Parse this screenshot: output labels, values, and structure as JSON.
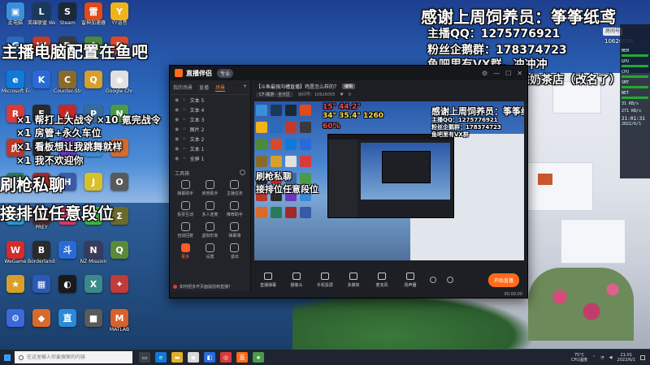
{
  "colors": {
    "accent": "#ff6a1a",
    "taskbar": "#1f2530",
    "app_bg": "#1e1f24"
  },
  "desktop_icons": [
    {
      "label": "此电脑",
      "icon": "computer-icon",
      "color": "#3a8fd8",
      "glyph": "▣"
    },
    {
      "label": "英雄联盟 WeGame版",
      "icon": "lol-icon",
      "color": "#1a3a5a",
      "glyph": "L"
    },
    {
      "label": "Steam",
      "icon": "steam-icon",
      "color": "#1b2838",
      "glyph": "S"
    },
    {
      "label": "雷神加速器",
      "icon": "accelerator-icon",
      "color": "#e24a1a",
      "glyph": "雷"
    },
    {
      "label": "YY语音",
      "icon": "yy-icon",
      "color": "#f0b41a",
      "glyph": "Y"
    },
    {
      "label": "",
      "icon": "app-icon",
      "color": "#2a6ab8",
      "glyph": "G"
    },
    {
      "label": "",
      "icon": "app-icon",
      "color": "#c23a2a",
      "glyph": "W"
    },
    {
      "label": "",
      "icon": "app-icon",
      "color": "#3a3a3a",
      "glyph": "D"
    },
    {
      "label": "",
      "icon": "app-icon",
      "color": "#4a8a3a",
      "glyph": "A"
    },
    {
      "label": "",
      "icon": "app-icon",
      "color": "#d84a2a",
      "glyph": "B"
    },
    {
      "label": "Microsoft Edge",
      "icon": "edge-icon",
      "color": "#0f7ad8",
      "glyph": "e"
    },
    {
      "label": "",
      "icon": "kook-icon",
      "color": "#2a6ad8",
      "glyph": "K"
    },
    {
      "label": "Counter-Strike",
      "icon": "cs-icon",
      "color": "#8a6a2a",
      "glyph": "C"
    },
    {
      "label": "",
      "icon": "app-icon",
      "color": "#d8a02a",
      "glyph": "Q"
    },
    {
      "label": "Google Chrome",
      "icon": "chrome-icon",
      "color": "#e0e0e0",
      "glyph": "◉"
    },
    {
      "label": "",
      "icon": "app-icon",
      "color": "#d83a3a",
      "glyph": "R"
    },
    {
      "label": "",
      "icon": "epic-icon",
      "color": "#2a2a2a",
      "glyph": "E"
    },
    {
      "label": "",
      "icon": "app-icon",
      "color": "#c22a2a",
      "glyph": "▲"
    },
    {
      "label": "",
      "icon": "app-icon",
      "color": "#3a6a9a",
      "glyph": "P"
    },
    {
      "label": "",
      "icon": "app-icon",
      "color": "#4a9a4a",
      "glyph": "N"
    },
    {
      "label": "",
      "icon": "app-icon",
      "color": "#b8382a",
      "glyph": "虎"
    },
    {
      "label": "",
      "icon": "app-icon",
      "color": "#2a2a2a",
      "glyph": "M"
    },
    {
      "label": "",
      "icon": "app-icon",
      "color": "#6a3ab8",
      "glyph": "V"
    },
    {
      "label": "",
      "icon": "app-icon",
      "color": "#3a8ad8",
      "glyph": "T"
    },
    {
      "label": "",
      "icon": "app-icon",
      "color": "#d86a2a",
      "glyph": "F"
    },
    {
      "label": "",
      "icon": "app-icon",
      "color": "#2a7a5a",
      "glyph": "X"
    },
    {
      "label": "",
      "icon": "app-icon",
      "color": "#a02a2a",
      "glyph": "Z"
    },
    {
      "label": "",
      "icon": "app-icon",
      "color": "#3a5aa8",
      "glyph": "H"
    },
    {
      "label": "",
      "icon": "app-icon",
      "color": "#d8c02a",
      "glyph": "J"
    },
    {
      "label": "",
      "icon": "app-icon",
      "color": "#5a5a5a",
      "glyph": "O"
    },
    {
      "label": "",
      "icon": "app-icon",
      "color": "#2a9ad8",
      "glyph": "U"
    },
    {
      "label": "PREY",
      "icon": "prey-icon",
      "color": "#4a2a2a",
      "glyph": "P"
    },
    {
      "label": "",
      "icon": "app-icon",
      "color": "#d83a6a",
      "glyph": "I"
    },
    {
      "label": "",
      "icon": "app-icon",
      "color": "#3ab83a",
      "glyph": "Ψ"
    },
    {
      "label": "",
      "icon": "app-icon",
      "color": "#6a6a2a",
      "glyph": "Σ"
    },
    {
      "label": "WeGame",
      "icon": "wegame-icon",
      "color": "#d82a2a",
      "glyph": "W"
    },
    {
      "label": "Borderlands",
      "icon": "borderlands-icon",
      "color": "#2a2a2a",
      "glyph": "B"
    },
    {
      "label": "",
      "icon": "app-icon",
      "color": "#2a6ad8",
      "glyph": "斗"
    },
    {
      "label": "NZ Mission",
      "icon": "app-icon",
      "color": "#3a3a5a",
      "glyph": "N"
    },
    {
      "label": "",
      "icon": "app-icon",
      "color": "#5a8a3a",
      "glyph": "Q"
    },
    {
      "label": "",
      "icon": "app-icon",
      "color": "#d8a02a",
      "glyph": "★"
    },
    {
      "label": "",
      "icon": "app-icon",
      "color": "#2a5ab8",
      "glyph": "▦"
    },
    {
      "label": "",
      "icon": "app-icon",
      "color": "#1a1a1a",
      "glyph": "◐"
    },
    {
      "label": "",
      "icon": "app-icon",
      "color": "#3a8a8a",
      "glyph": "X"
    },
    {
      "label": "",
      "icon": "app-icon",
      "color": "#c23a3a",
      "glyph": "✦"
    },
    {
      "label": "",
      "icon": "app-icon",
      "color": "#3a6ad8",
      "glyph": "⚙"
    },
    {
      "label": "",
      "icon": "app-icon",
      "color": "#d86a2a",
      "glyph": "◆"
    },
    {
      "label": "",
      "icon": "app-icon",
      "color": "#2a8ad8",
      "glyph": "直"
    },
    {
      "label": "",
      "icon": "app-icon",
      "color": "#5a5a5a",
      "glyph": "■"
    },
    {
      "label": "MATLAB",
      "icon": "matlab-icon",
      "color": "#d8602a",
      "glyph": "M"
    }
  ],
  "overlay": {
    "left_lines": [
      "主播电脑配置在鱼吧",
      "×1 帮打上大战令 ×10 氪完战令",
      "×1 房管+永久车位",
      "×1 看板想让我跳舞就样",
      "×1 我不欢迎你",
      "刷枪私聊",
      "接排位任意段位"
    ],
    "right_lines": [
      "感谢上周饲养员：筝筝纸鸢",
      "主播QQ：1275776921",
      "粉丝企鹅群：178374723",
      "鱼吧里有VX群，冲冲冲",
      "战队名称搜索：解忧奶茶店（改名了）"
    ]
  },
  "sysmon": {
    "viewers_label": "房间号",
    "viewers_count": "10626006",
    "rows": [
      "MEM",
      "GPU",
      "CPU",
      "SMT",
      "NET"
    ],
    "net_up": "31 KB/s",
    "net_down": "271 KB/s",
    "time": "21:01:31",
    "date": "2022/6/1"
  },
  "app": {
    "brand": "直播伴侣",
    "badge": "专业",
    "scene_tabs": [
      "我的场景",
      "直播",
      "场景"
    ],
    "sources": [
      "文本 5",
      "文本 4",
      "文本 3",
      "图片 2",
      "文本 2",
      "文本 1",
      "全屏 1"
    ],
    "tools_title": "工具箱",
    "tools": [
      "弹幕助手",
      "房管助手",
      "主播任务",
      "投票互动",
      "多人连麦",
      "推荐助手",
      "自动回复",
      "虚拟形象",
      "弹幕墙",
      "更多",
      "设置",
      "退出"
    ],
    "notice": "如何把多开页面提前到直播？",
    "room_title": "【斗鱼最强沟槽直播】鸡是怎么样的？",
    "room_tag": "编辑",
    "room_category": "CF-端游 · 全分区",
    "room_id": "房间号：10626005",
    "room_fans": "0",
    "preview_overlays": [
      "感谢上周饲养员：筝筝纸鸢",
      "主播QQ：1275776921",
      "粉丝企鹅群：178374723",
      "鱼吧里有VX群",
      "刷枪私聊",
      "接排位任意段位"
    ],
    "preview_stats": [
      "15°  44.2°",
      "34°  35.4°  1260",
      "60%"
    ],
    "bottom_tools": [
      "直播弹幕",
      "摄像头",
      "手机投屏",
      "多媒体",
      "麦克风",
      "扬声器"
    ],
    "go_live": "开始直播",
    "status": "00:00:00"
  },
  "taskbar": {
    "search_placeholder": "在这里输入你要搜索的内容",
    "apps": [
      {
        "icon": "task-view-icon",
        "color": "#3a3f4a",
        "glyph": "▭"
      },
      {
        "icon": "edge-icon",
        "color": "#0f7ad8",
        "glyph": "e"
      },
      {
        "icon": "explorer-icon",
        "color": "#e0b02a",
        "glyph": "▬"
      },
      {
        "icon": "chrome-icon",
        "color": "#d8d8d8",
        "glyph": "◉"
      },
      {
        "icon": "store-icon",
        "color": "#2a6ad8",
        "glyph": "◧"
      },
      {
        "icon": "app-icon",
        "color": "#d83a3a",
        "glyph": "◎"
      },
      {
        "icon": "app-icon",
        "color": "#ff6a1a",
        "glyph": "直"
      },
      {
        "icon": "app-icon",
        "color": "#4a9a4a",
        "glyph": "★"
      }
    ],
    "temperature": "75°C",
    "temperature_label": "CPU温度",
    "clock": "21:01",
    "date": "2022/6/1"
  }
}
